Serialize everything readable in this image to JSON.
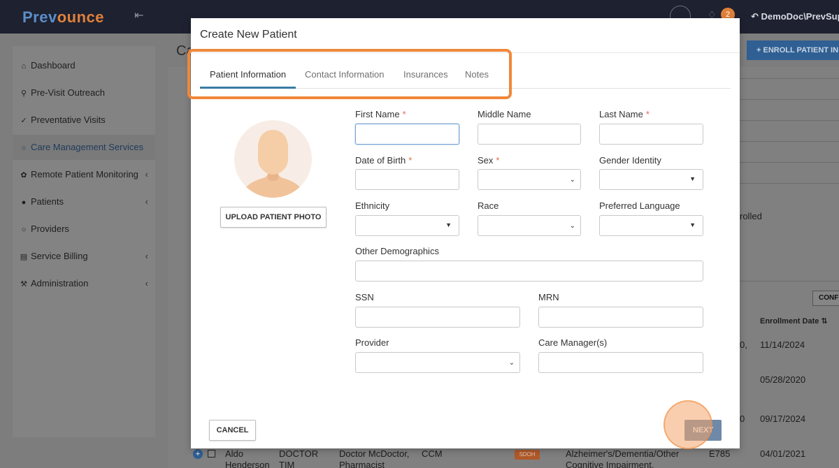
{
  "app": {
    "logo_part1": "Prev",
    "logo_part2": "ounce",
    "notification_count": "2",
    "user_name": "DemoDoc\\PrevSup"
  },
  "sidebar": {
    "items": [
      {
        "label": "Dashboard",
        "icon": "home-icon"
      },
      {
        "label": "Pre-Visit Outreach",
        "icon": "search-people-icon"
      },
      {
        "label": "Preventative Visits",
        "icon": "check-circle-icon"
      },
      {
        "label": "Care Management Services",
        "icon": "chat-icon"
      },
      {
        "label": "Remote Patient Monitoring",
        "icon": "signal-icon"
      },
      {
        "label": "Patients",
        "icon": "users-icon"
      },
      {
        "label": "Providers",
        "icon": "user-icon"
      },
      {
        "label": "Service Billing",
        "icon": "document-icon"
      },
      {
        "label": "Administration",
        "icon": "wrench-icon"
      }
    ]
  },
  "background": {
    "page_title": "Ca",
    "enroll_button": "+ ENROLL PATIENT IN C",
    "enrolled_text": "rolled",
    "config_button": "CONFI",
    "enrollment_date_header": "Enrollment Date",
    "rows": [
      {
        "col_a": "0,",
        "date": "11/14/2024"
      },
      {
        "col_a": "",
        "date": "05/28/2020"
      },
      {
        "col_a": "0",
        "date": "09/17/2024"
      }
    ],
    "last_row": {
      "name_line1": "Aldo",
      "name_line2": "Henderson",
      "provider_line1": "DOCTOR",
      "provider_line2": "TIM",
      "care_line1": "Doctor McDoctor,",
      "care_line2": "Pharmacist",
      "program": "CCM",
      "tag": "SDOH",
      "condition_line1": "Alzheimer's/Dementia/Other",
      "condition_line2": "Cognitive Impairment,",
      "code": "E785",
      "date": "04/01/2021"
    }
  },
  "modal": {
    "title": "Create New Patient",
    "tabs": [
      {
        "label": "Patient Information"
      },
      {
        "label": "Contact Information"
      },
      {
        "label": "Insurances"
      },
      {
        "label": "Notes"
      }
    ],
    "upload_photo_label": "UPLOAD PATIENT PHOTO",
    "fields": {
      "first_name": "First Name",
      "middle_name": "Middle Name",
      "last_name": "Last Name",
      "dob": "Date of Birth",
      "sex": "Sex",
      "gender_identity": "Gender Identity",
      "ethnicity": "Ethnicity",
      "race": "Race",
      "preferred_language": "Preferred Language",
      "other_demographics": "Other Demographics",
      "ssn": "SSN",
      "mrn": "MRN",
      "provider": "Provider",
      "care_managers": "Care Manager(s)"
    },
    "required_marker": "*",
    "cancel_label": "CANCEL",
    "next_label": "NEXT"
  }
}
